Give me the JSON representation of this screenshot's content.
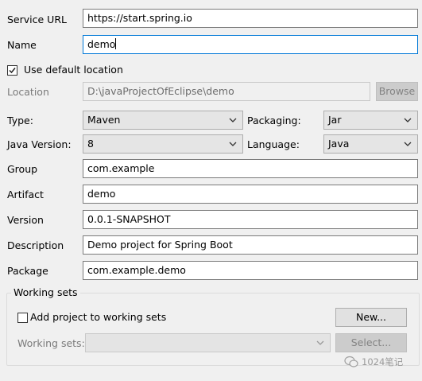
{
  "service_url": {
    "label": "Service URL",
    "value": "https://start.spring.io"
  },
  "name": {
    "label": "Name",
    "value": "demo"
  },
  "use_default_location": {
    "label": "Use default location",
    "checked": true
  },
  "location": {
    "label": "Location",
    "value": "D:\\javaProjectOfEclipse\\demo",
    "browse_label": "Browse"
  },
  "type": {
    "label": "Type:",
    "value": "Maven"
  },
  "packaging": {
    "label": "Packaging:",
    "value": "Jar"
  },
  "java_version": {
    "label": "Java Version:",
    "value": "8"
  },
  "language": {
    "label": "Language:",
    "value": "Java"
  },
  "group": {
    "label": "Group",
    "value": "com.example"
  },
  "artifact": {
    "label": "Artifact",
    "value": "demo"
  },
  "version": {
    "label": "Version",
    "value": "0.0.1-SNAPSHOT"
  },
  "description": {
    "label": "Description",
    "value": "Demo project for Spring Boot"
  },
  "package": {
    "label": "Package",
    "value": "com.example.demo"
  },
  "working_sets": {
    "title": "Working sets",
    "add_label": "Add project to working sets",
    "add_checked": false,
    "new_button": "New...",
    "combo_label": "Working sets:",
    "combo_value": "",
    "select_button": "Select..."
  },
  "watermark": {
    "text": "1024笔记"
  },
  "colors": {
    "focus_border": "#0078d7",
    "window_bg": "#f0f0f0"
  }
}
